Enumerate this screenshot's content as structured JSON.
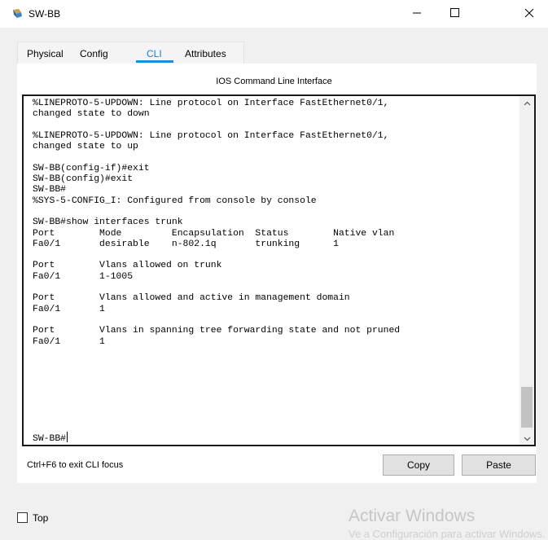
{
  "window": {
    "title": "SW-BB"
  },
  "tabs": [
    {
      "label": "Physical"
    },
    {
      "label": "Config"
    },
    {
      "label": "CLI"
    },
    {
      "label": "Attributes"
    }
  ],
  "active_tab": "CLI",
  "cli": {
    "heading": "IOS Command Line Interface",
    "output_lines": [
      "%LINEPROTO-5-UPDOWN: Line protocol on Interface FastEthernet0/1,",
      "changed state to down",
      "",
      "%LINEPROTO-5-UPDOWN: Line protocol on Interface FastEthernet0/1,",
      "changed state to up",
      "",
      "SW-BB(config-if)#exit",
      "SW-BB(config)#exit",
      "SW-BB#",
      "%SYS-5-CONFIG_I: Configured from console by console",
      "",
      "SW-BB#show interfaces trunk",
      "Port        Mode         Encapsulation  Status        Native vlan",
      "Fa0/1       desirable    n-802.1q       trunking      1",
      "",
      "Port        Vlans allowed on trunk",
      "Fa0/1       1-1005",
      "",
      "Port        Vlans allowed and active in management domain",
      "Fa0/1       1",
      "",
      "Port        Vlans in spanning tree forwarding state and not pruned",
      "Fa0/1       1",
      ""
    ],
    "prompt": "SW-BB#"
  },
  "footer": {
    "hint": "Ctrl+F6 to exit CLI focus",
    "copy_label": "Copy",
    "paste_label": "Paste"
  },
  "bottom": {
    "top_label": "Top",
    "top_checked": false
  },
  "watermark": {
    "line1": "Activar Windows",
    "line2": "Ve a Configuración para activar Windows."
  },
  "icons": {
    "app": "packet-tracer-switch-icon",
    "minimize": "minimize-icon",
    "maximize": "maximize-icon",
    "close": "close-icon",
    "scroll_up": "chevron-up-icon",
    "scroll_down": "chevron-down-icon"
  }
}
